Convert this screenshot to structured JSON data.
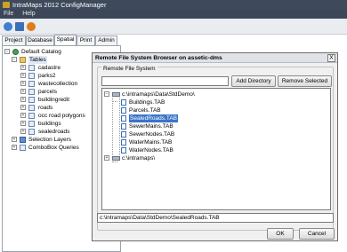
{
  "app": {
    "title": "IntraMaps 2012 ConfigManager"
  },
  "menu": {
    "items": [
      "File",
      "Help"
    ]
  },
  "tabs": [
    "Project",
    "Database",
    "Spatial",
    "Print",
    "Admin"
  ],
  "active_tab": "Spatial",
  "tree": {
    "root": "Default Catalog",
    "tables": "Tables",
    "items": [
      "cadastre",
      "parks2",
      "wastecollection",
      "parcels",
      "buildingredit",
      "roads",
      "occ road polygons",
      "buildings",
      "sealedroads"
    ],
    "selection_layers": "Selection Layers",
    "combobox_queries": "ComboBox Queries"
  },
  "background_text": {
    "big": "l",
    "small": "ha"
  },
  "dialog": {
    "title": "Remote File System Browser on assetic-dms",
    "close": "X",
    "group_label": "Remote File System",
    "path_input": "",
    "add_directory": "Add Directory",
    "remove_selected": "Remove Selected",
    "list": {
      "dir1": "c:\\intramaps\\Data\\StdDemo\\",
      "files": [
        "Buildings.TAB",
        "Parcels.TAB",
        "SealedRoads.TAB",
        "SewerMains.TAB",
        "SewerNodes.TAB",
        "WaterMains.TAB",
        "WaterNodes.TAB"
      ],
      "selected": "SealedRoads.TAB",
      "dir2": "c:\\intramaps\\"
    },
    "selected_path": "c:\\intramaps\\Data\\StdDemo\\SealedRoads.TAB",
    "ok": "OK",
    "cancel": "Cancel"
  }
}
